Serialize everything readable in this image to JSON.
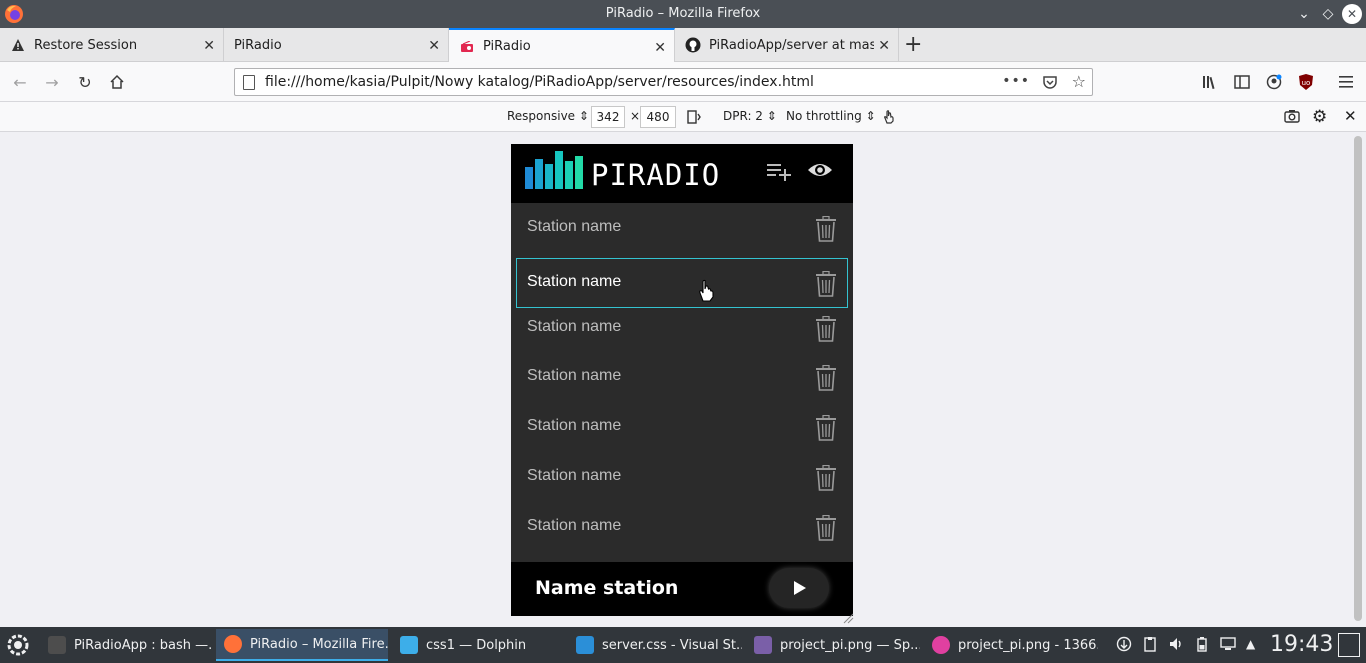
{
  "window": {
    "title": "PiRadio – Mozilla Firefox"
  },
  "tabs": [
    {
      "label": "Restore Session",
      "icon": "warning-icon"
    },
    {
      "label": "PiRadio",
      "icon": ""
    },
    {
      "label": "PiRadio",
      "icon": "radio-icon"
    },
    {
      "label": "PiRadioApp/server at mas",
      "icon": "github-icon"
    }
  ],
  "navbar": {
    "url": "file:///home/kasia/Pulpit/Nowy katalog/PiRadioApp/server/resources/index.html",
    "more": "•••"
  },
  "rdm": {
    "device": "Responsive",
    "width": "342",
    "times": "×",
    "height": "480",
    "dpr": "DPR: 2",
    "throttling": "No throttling"
  },
  "app": {
    "logo_text": "PIRADIO",
    "stations": [
      {
        "name": "Station name",
        "hovered": false
      },
      {
        "name": "Station name",
        "hovered": true
      },
      {
        "name": "Station name",
        "hovered": false
      },
      {
        "name": "Station name",
        "hovered": false
      },
      {
        "name": "Station name",
        "hovered": false
      },
      {
        "name": "Station name",
        "hovered": false
      },
      {
        "name": "Station name",
        "hovered": false
      }
    ],
    "footer_title": "Name station",
    "colors": {
      "accent": "#34c3d0",
      "background": "#2b2b2b",
      "header": "#000000"
    }
  },
  "taskbar": {
    "tasks": [
      {
        "label": "PiRadioApp : bash —...",
        "icon": "terminal-icon"
      },
      {
        "label": "PiRadio – Mozilla Fire...",
        "icon": "firefox-icon"
      },
      {
        "label": "css1 — Dolphin",
        "icon": "folder-icon"
      },
      {
        "label": "server.css - Visual St...",
        "icon": "vscode-icon"
      },
      {
        "label": "project_pi.png — Sp...",
        "icon": "spectacle-icon"
      },
      {
        "label": "project_pi.png - 1366...",
        "icon": "image-viewer-icon"
      }
    ],
    "clock": "19:43"
  }
}
